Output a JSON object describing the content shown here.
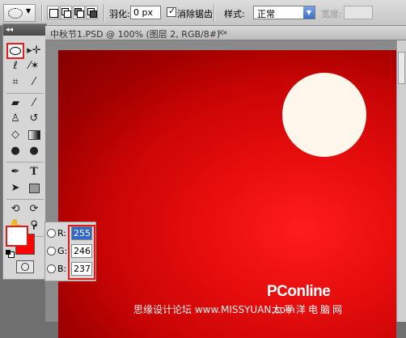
{
  "options_bar": {
    "feather_label": "羽化:",
    "feather_value": "0 px",
    "antialias_label": "消除锯齿",
    "antialias_checked": true,
    "style_label": "样式:",
    "style_value": "正常",
    "width_label": "宽度:"
  },
  "document": {
    "tab_title": "中秋节1.PSD @ 100% (图层 2, RGB/8#) *",
    "close_glyph": "×"
  },
  "toolbox": {
    "collapse_glyph": "◂◂",
    "selected_tool": "elliptical-marquee"
  },
  "colors": {
    "foreground": "#ffffff",
    "background": "#ff0000",
    "highlight": "#e01818"
  },
  "rgb_picker": {
    "r_label": "R:",
    "r_value": "255",
    "g_label": "G:",
    "g_value": "246",
    "b_label": "B:",
    "b_value": "237"
  },
  "watermarks": {
    "brand": "PConline",
    "brand_cn": "太平洋电脑网",
    "site": "思缘设计论坛  www.MISSYUAN.com"
  }
}
